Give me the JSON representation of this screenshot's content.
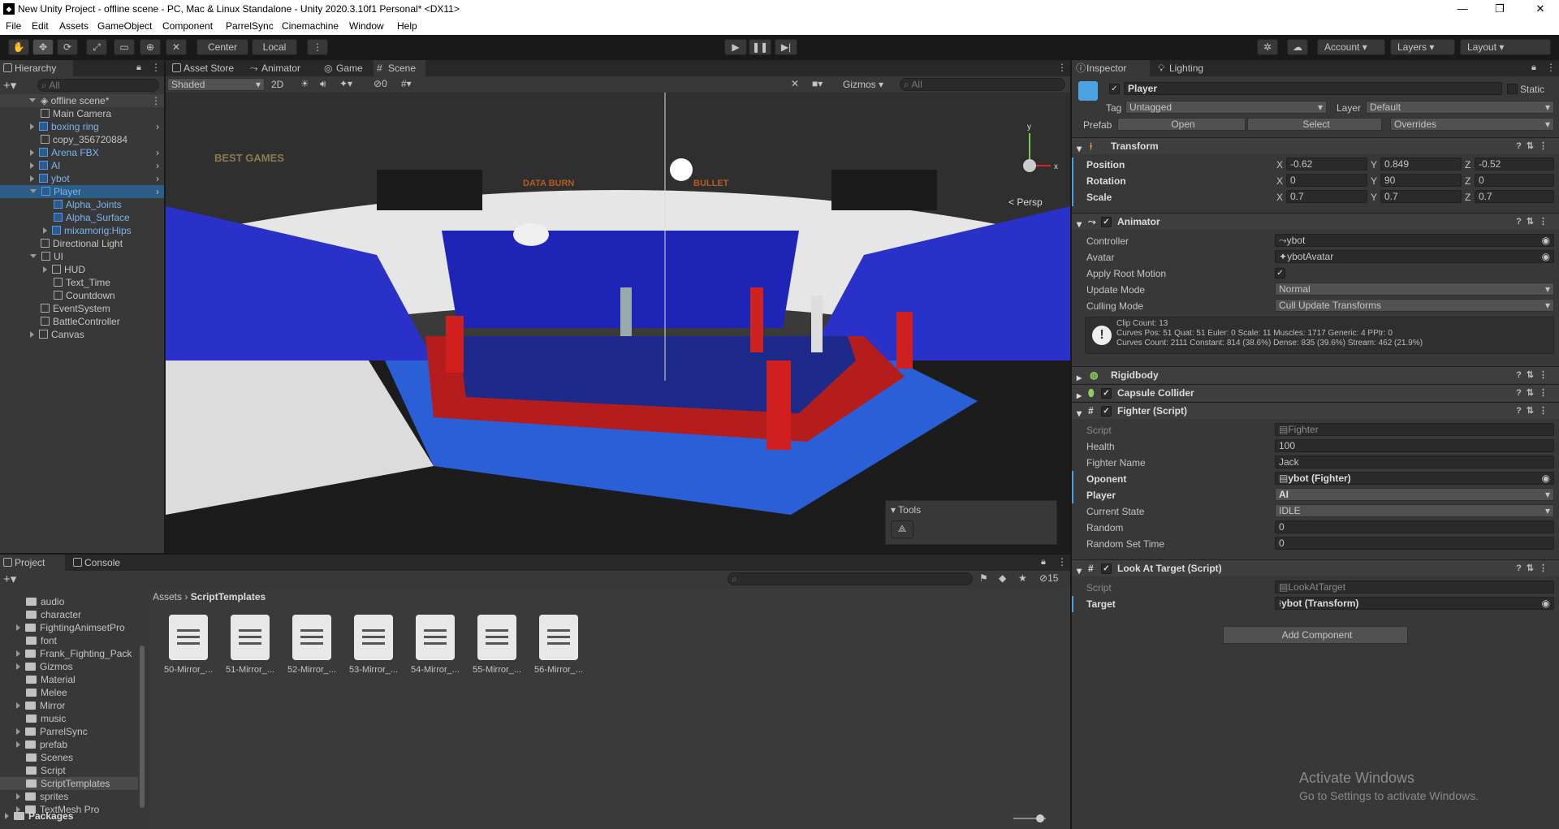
{
  "window": {
    "title": "New Unity Project - offline scene - PC, Mac & Linux Standalone - Unity 2020.3.10f1 Personal* <DX11>",
    "minimize": "—",
    "maximize": "❐",
    "close": "✕"
  },
  "menu": [
    "File",
    "Edit",
    "Assets",
    "GameObject",
    "Component",
    "ParrelSync",
    "Cinemachine",
    "Window",
    "Help"
  ],
  "toolbar": {
    "pivot_center": "Center",
    "pivot_local": "Local",
    "account": "Account",
    "layers": "Layers",
    "layout": "Layout"
  },
  "hierarchy": {
    "tab": "Hierarchy",
    "search_placeholder": "All",
    "scene": "offline scene*",
    "items": [
      {
        "label": "Main Camera",
        "depth": 1,
        "prefab": false,
        "fold": "none"
      },
      {
        "label": "boxing ring",
        "depth": 1,
        "prefab": true,
        "fold": "closed"
      },
      {
        "label": "copy_356720884",
        "depth": 1,
        "prefab": false,
        "fold": "none"
      },
      {
        "label": "Arena FBX",
        "depth": 1,
        "prefab": true,
        "fold": "closed"
      },
      {
        "label": "AI",
        "depth": 1,
        "prefab": true,
        "fold": "closed"
      },
      {
        "label": "ybot",
        "depth": 1,
        "prefab": true,
        "fold": "closed"
      },
      {
        "label": "Player",
        "depth": 1,
        "prefab": true,
        "fold": "open",
        "selected": true
      },
      {
        "label": "Alpha_Joints",
        "depth": 2,
        "prefab": true,
        "fold": "none"
      },
      {
        "label": "Alpha_Surface",
        "depth": 2,
        "prefab": true,
        "fold": "none"
      },
      {
        "label": "mixamorig:Hips",
        "depth": 2,
        "prefab": true,
        "fold": "closed"
      },
      {
        "label": "Directional Light",
        "depth": 1,
        "prefab": false,
        "fold": "none"
      },
      {
        "label": "UI",
        "depth": 1,
        "prefab": false,
        "fold": "open"
      },
      {
        "label": "HUD",
        "depth": 2,
        "prefab": false,
        "fold": "closed"
      },
      {
        "label": "Text_Time",
        "depth": 2,
        "prefab": false,
        "fold": "none"
      },
      {
        "label": "Countdown",
        "depth": 2,
        "prefab": false,
        "fold": "none"
      },
      {
        "label": "EventSystem",
        "depth": 1,
        "prefab": false,
        "fold": "none"
      },
      {
        "label": "BattleController",
        "depth": 1,
        "prefab": false,
        "fold": "none"
      },
      {
        "label": "Canvas",
        "depth": 1,
        "prefab": false,
        "fold": "closed"
      }
    ]
  },
  "scene_tabs": [
    "Asset Store",
    "Animator",
    "Game",
    "Scene"
  ],
  "scene_toolbar": {
    "shading": "Shaded",
    "mode_2d": "2D",
    "hidden_count": "0",
    "gizmos": "Gizmos",
    "search_placeholder": "All",
    "persp": "< Persp",
    "tools_overlay": "Tools"
  },
  "scene_signs": {
    "left": "BEST GAMES",
    "center": "DATA BURN",
    "right": "BULLET"
  },
  "inspector": {
    "tabs": [
      "Inspector",
      "Lighting"
    ],
    "object_name": "Player",
    "static_label": "Static",
    "tag_label": "Tag",
    "tag_value": "Untagged",
    "layer_label": "Layer",
    "layer_value": "Default",
    "prefab_label": "Prefab",
    "prefab_open": "Open",
    "prefab_select": "Select",
    "prefab_overrides": "Overrides",
    "transform": {
      "title": "Transform",
      "rows": [
        {
          "label": "Position",
          "x": "-0.62",
          "y": "0.849",
          "z": "-0.52"
        },
        {
          "label": "Rotation",
          "x": "0",
          "y": "90",
          "z": "0"
        },
        {
          "label": "Scale",
          "x": "0.7",
          "y": "0.7",
          "z": "0.7"
        }
      ]
    },
    "animator": {
      "title": "Animator",
      "controller_label": "Controller",
      "controller_value": "ybot",
      "avatar_label": "Avatar",
      "avatar_value": "ybotAvatar",
      "root_motion_label": "Apply Root Motion",
      "update_mode_label": "Update Mode",
      "update_mode_value": "Normal",
      "culling_mode_label": "Culling Mode",
      "culling_mode_value": "Cull Update Transforms",
      "info_line1": "Clip Count: 13",
      "info_line2": "Curves Pos: 51 Quat: 51 Euler: 0 Scale: 11 Muscles: 1717 Generic: 4 PPtr: 0",
      "info_line3": "Curves Count: 2111 Constant: 814 (38.6%) Dense: 835 (39.6%) Stream: 462 (21.9%)"
    },
    "rigidbody": "Rigidbody",
    "capsule": "Capsule Collider",
    "fighter": {
      "title": "Fighter (Script)",
      "script_label": "Script",
      "script_value": "Fighter",
      "health_label": "Health",
      "health_value": "100",
      "name_label": "Fighter Name",
      "name_value": "Jack",
      "oponent_label": "Oponent",
      "oponent_value": "ybot (Fighter)",
      "player_label": "Player",
      "player_value": "AI",
      "state_label": "Current State",
      "state_value": "IDLE",
      "random_label": "Random",
      "random_value": "0",
      "rst_label": "Random Set Time",
      "rst_value": "0"
    },
    "look": {
      "title": "Look At Target (Script)",
      "script_label": "Script",
      "script_value": "LookAtTarget",
      "target_label": "Target",
      "target_value": "ybot (Transform)"
    },
    "add_component": "Add Component",
    "watermark_title": "Activate Windows",
    "watermark_sub": "Go to Settings to activate Windows."
  },
  "project": {
    "tabs": [
      "Project",
      "Console"
    ],
    "hidden_count": "15",
    "breadcrumb_root": "Assets",
    "breadcrumb_current": "ScriptTemplates",
    "folders": [
      {
        "label": "audio",
        "fold": false
      },
      {
        "label": "character",
        "fold": false
      },
      {
        "label": "FightingAnimsetPro",
        "fold": true
      },
      {
        "label": "font",
        "fold": false
      },
      {
        "label": "Frank_Fighting_Pack",
        "fold": true
      },
      {
        "label": "Gizmos",
        "fold": true
      },
      {
        "label": "Material",
        "fold": false
      },
      {
        "label": "Melee",
        "fold": false
      },
      {
        "label": "Mirror",
        "fold": true
      },
      {
        "label": "music",
        "fold": false
      },
      {
        "label": "ParrelSync",
        "fold": true
      },
      {
        "label": "prefab",
        "fold": true
      },
      {
        "label": "Scenes",
        "fold": false
      },
      {
        "label": "Script",
        "fold": false
      },
      {
        "label": "ScriptTemplates",
        "fold": false,
        "selected": true
      },
      {
        "label": "sprites",
        "fold": true
      },
      {
        "label": "TextMesh Pro",
        "fold": true
      }
    ],
    "packages": "Packages",
    "files": [
      "50-Mirror_...",
      "51-Mirror_...",
      "52-Mirror_...",
      "53-Mirror_...",
      "54-Mirror_...",
      "55-Mirror_...",
      "56-Mirror_..."
    ]
  },
  "colors": {
    "accent_select": "#2c5d87",
    "prefab_blue": "#7bb4f0",
    "panel": "#383838",
    "header": "#282828"
  }
}
